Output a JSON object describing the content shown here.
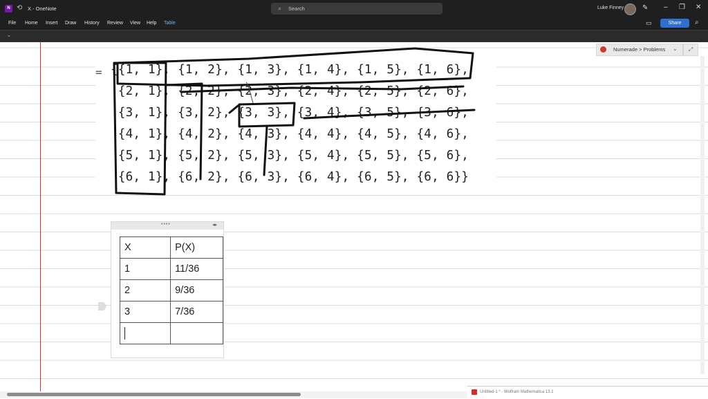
{
  "window": {
    "app_icon_label": "N",
    "title": "X - OneNote",
    "search_placeholder": "Search",
    "user_name": "Luke Finney"
  },
  "ribbon": {
    "tabs": [
      {
        "label": "File"
      },
      {
        "label": "Home"
      },
      {
        "label": "Insert"
      },
      {
        "label": "Draw"
      },
      {
        "label": "History"
      },
      {
        "label": "Review"
      },
      {
        "label": "View"
      },
      {
        "label": "Help"
      },
      {
        "label": "Table",
        "active": true
      }
    ],
    "share_label": "Share"
  },
  "page": {
    "breadcrumb": "Numerade > Problems",
    "equals_sign": "=",
    "math_rows": [
      "{{1, 1}, {1, 2}, {1, 3}, {1, 4}, {1, 5}, {1, 6},",
      " {2, 1}, {2, 2}, {2, 3}, {2, 4}, {2, 5}, {2, 6},",
      " {3, 1}, {3, 2}, {3, 3}, {3, 4}, {3, 5}, {3, 6},",
      " {4, 1}, {4, 2}, {4, 3}, {4, 4}, {4, 5}, {4, 6},",
      " {5, 1}, {5, 2}, {5, 3}, {5, 4}, {5, 5}, {5, 6},",
      " {6, 1}, {6, 2}, {6, 3}, {6, 4}, {6, 5}, {6, 6}}"
    ],
    "table": {
      "header": [
        "X",
        "P(X)"
      ],
      "rows": [
        [
          "1",
          "11/36"
        ],
        [
          "2",
          "9/36"
        ],
        [
          "3",
          "7/36"
        ]
      ]
    }
  },
  "taskbar": {
    "preview_label": "Untitled-1 * - Wolfram Mathematica 13.1"
  },
  "colors": {
    "titlebar": "#1f1f1f",
    "active_tab": "#6cb8f6",
    "share_button": "#2f6fd1",
    "margin_line": "#d8302f",
    "rule_line": "#cfe2ec"
  }
}
